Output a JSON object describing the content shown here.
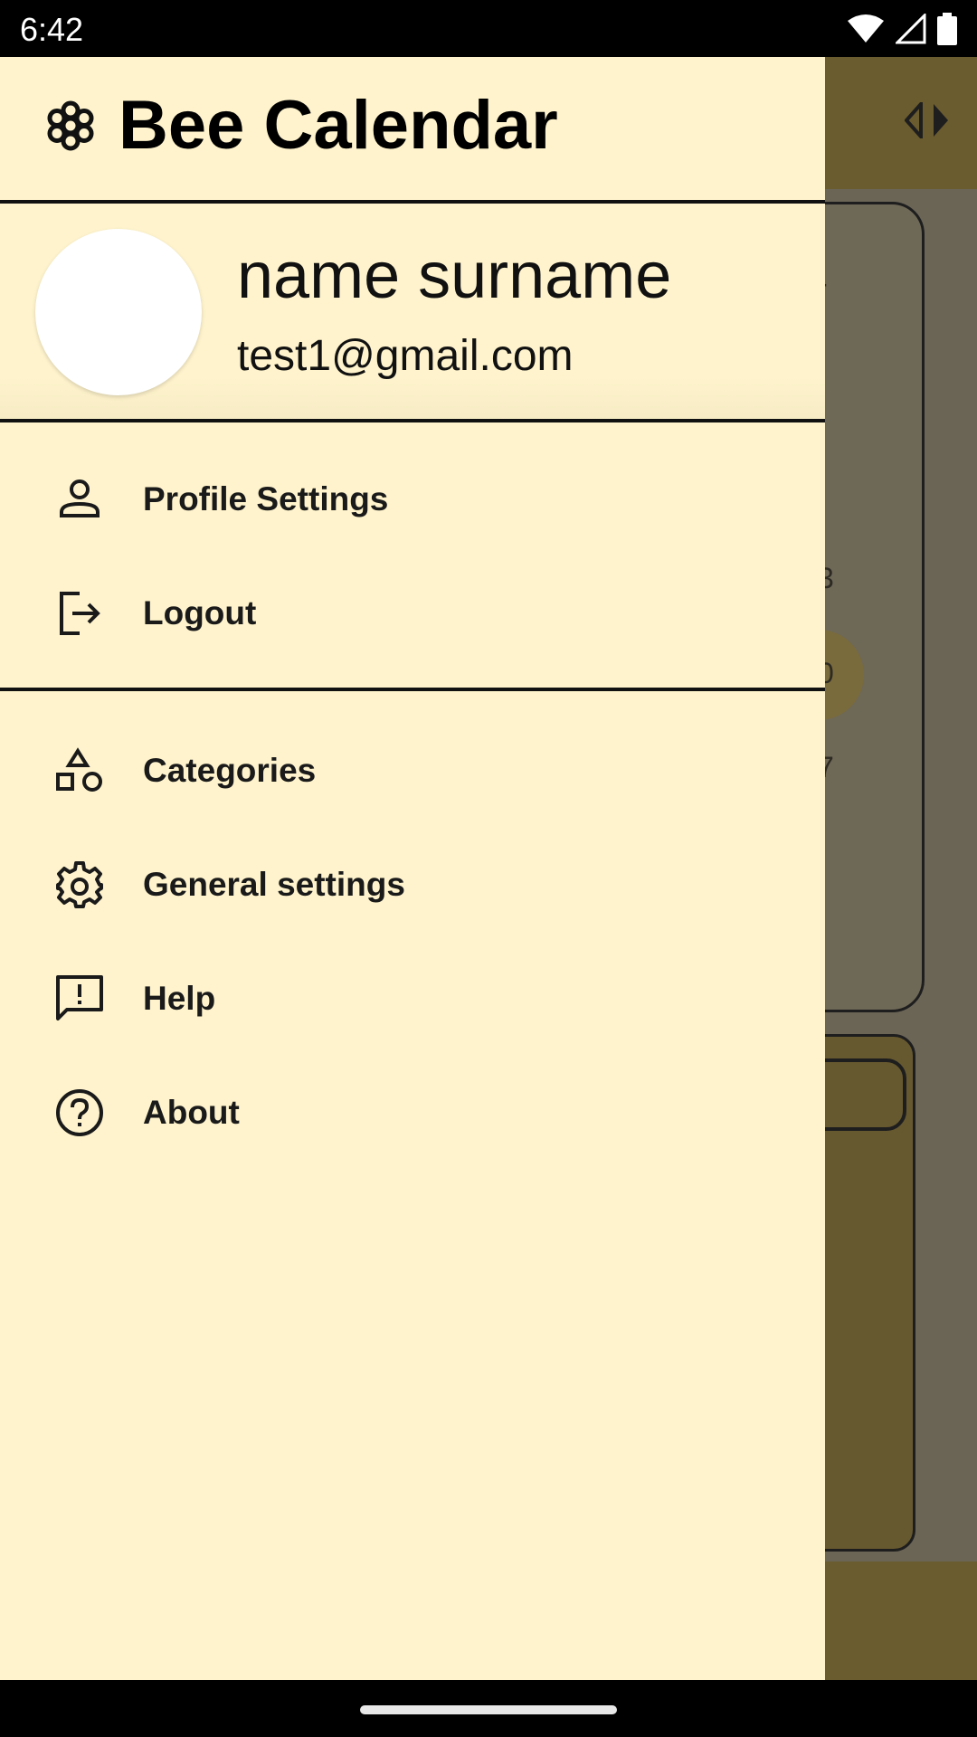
{
  "status_bar": {
    "time": "6:42",
    "icons": [
      "wifi-icon",
      "signal-icon",
      "battery-icon"
    ]
  },
  "drawer": {
    "app_title": "Bee Calendar",
    "brand_icon": "flower-icon",
    "user": {
      "name": "name surname",
      "email": "test1@gmail.com"
    },
    "account_items": [
      {
        "label": "Profile Settings",
        "icon": "person-icon"
      },
      {
        "label": "Logout",
        "icon": "logout-icon"
      }
    ],
    "app_items": [
      {
        "label": "Categories",
        "icon": "categories-icon"
      },
      {
        "label": "General settings",
        "icon": "gear-icon"
      },
      {
        "label": "Help",
        "icon": "feedback-icon"
      },
      {
        "label": "About",
        "icon": "help-circle-icon"
      }
    ]
  },
  "background": {
    "calendar_fragments": [
      "-",
      "3",
      "0",
      "7"
    ]
  },
  "colors": {
    "drawer_bg": "#fef3cc",
    "scrim_bg": "#6b6556",
    "app_bar": "#6a5c2e"
  }
}
